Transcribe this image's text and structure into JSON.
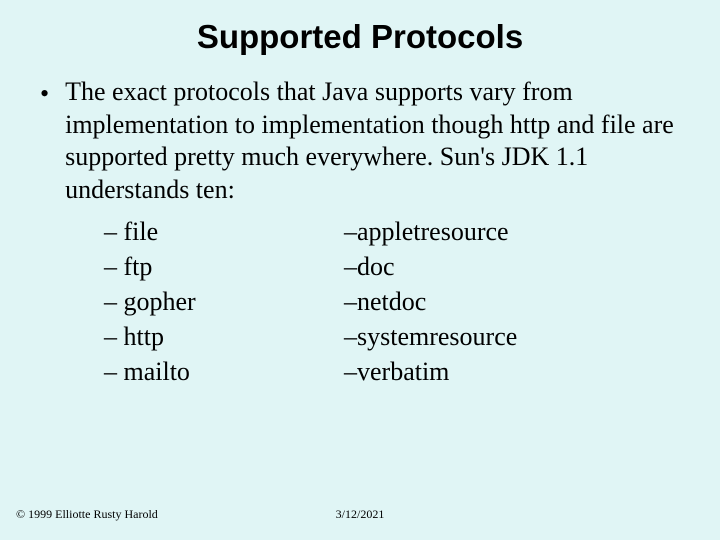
{
  "title": "Supported Protocols",
  "body": "The exact protocols that Java supports vary from implementation to implementation though http and file are supported pretty much everywhere. Sun's JDK 1.1 understands ten:",
  "left_list": [
    "file",
    "ftp",
    "gopher",
    "http",
    "mailto"
  ],
  "right_list": [
    "appletresource",
    "doc",
    "netdoc",
    "systemresource",
    "verbatim"
  ],
  "footer_left": "© 1999 Elliotte Rusty Harold",
  "footer_center": "3/12/2021"
}
